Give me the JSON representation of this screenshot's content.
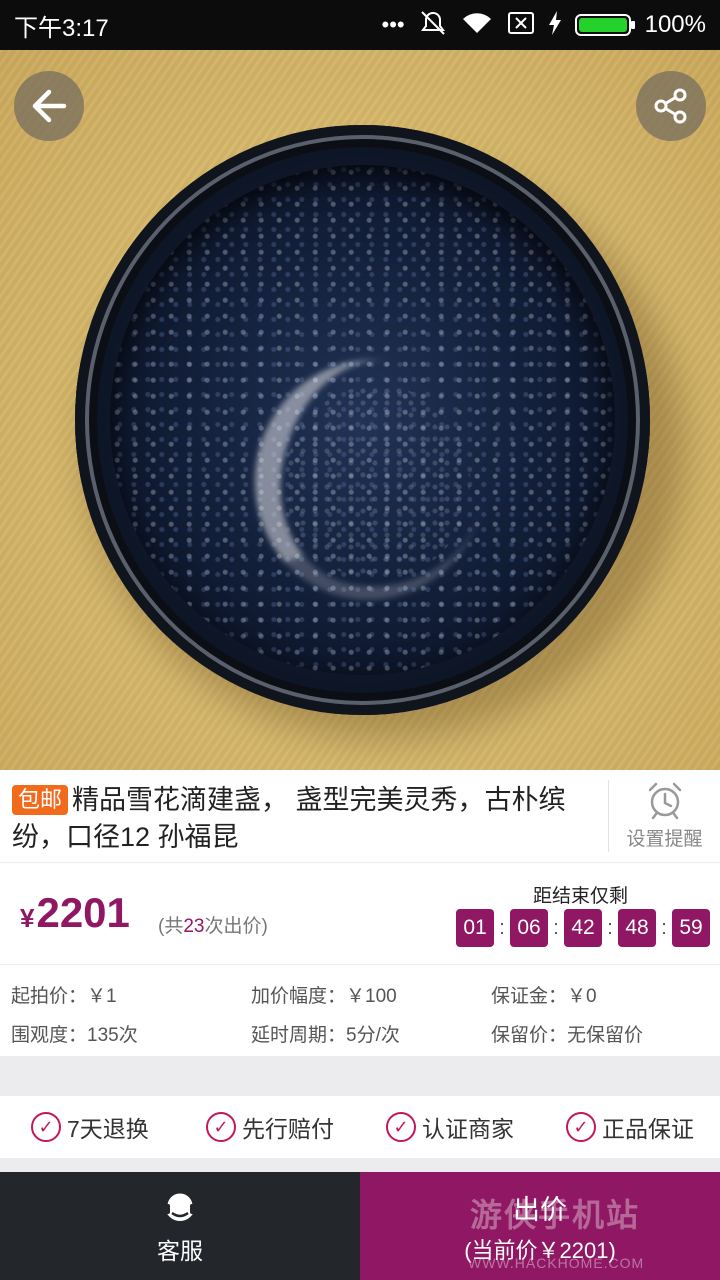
{
  "status_bar": {
    "time": "下午3:17",
    "battery_text": "100%",
    "battery_level": 1.0,
    "icons": [
      "more-dots-icon",
      "mute-icon",
      "wifi-icon",
      "no-sim-icon",
      "charging-icon",
      "battery-icon"
    ]
  },
  "hero": {
    "back_icon": "arrow-left-icon",
    "share_icon": "share-icon"
  },
  "item": {
    "tag": "包邮",
    "title": "精品雪花滴建盏， 盏型完美灵秀，古朴缤纷，口径12 孙福昆",
    "remind_label": "设置提醒",
    "remind_icon": "alarm-clock-icon"
  },
  "price": {
    "currency": "¥",
    "value": "2201",
    "bids_prefix": "(共",
    "bids_count": "23",
    "bids_suffix": "次出价)"
  },
  "countdown": {
    "label": "距结束仅剩",
    "values": [
      "01",
      "06",
      "42",
      "48",
      "59"
    ]
  },
  "info": {
    "start_price": "起拍价：￥1",
    "increment": "加价幅度：￥100",
    "deposit": "保证金：￥0",
    "views": "围观度：135次",
    "delay": "延时周期：5分/次",
    "reserve": "保留价：无保留价"
  },
  "guarantees": [
    "7天退换",
    "先行赔付",
    "认证商家",
    "正品保证"
  ],
  "bottom": {
    "service_label": "客服",
    "bid_label": "出价",
    "bid_sub": "(当前价￥2201)"
  },
  "watermark": {
    "text": "游侠手机站",
    "url": "WWW.HACKHOME.COM"
  },
  "colors": {
    "accent": "#8f1763",
    "tag": "#f26b1d",
    "check": "#c2185b",
    "battery": "#25d12b"
  }
}
